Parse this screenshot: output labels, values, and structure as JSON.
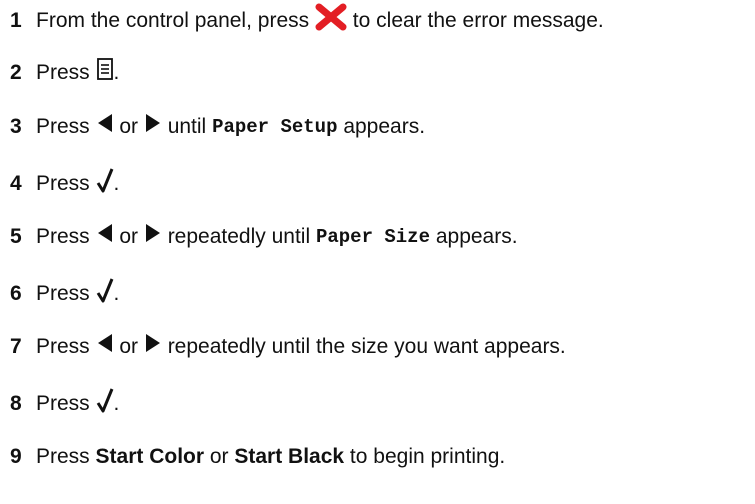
{
  "steps": [
    {
      "number": "1",
      "parts": {
        "a": "From the control panel, press ",
        "b": " to clear the error message."
      },
      "icons": [
        "cancel-x-icon"
      ]
    },
    {
      "number": "2",
      "parts": {
        "a": "Press ",
        "b": "."
      },
      "icons": [
        "menu-icon"
      ]
    },
    {
      "number": "3",
      "parts": {
        "a": "Press ",
        "or": " or ",
        "until": " until ",
        "code": "Paper Setup",
        "end": " appears."
      },
      "icons": [
        "left-arrow-icon",
        "right-arrow-icon"
      ]
    },
    {
      "number": "4",
      "parts": {
        "a": "Press ",
        "b": "."
      },
      "icons": [
        "checkmark-icon"
      ]
    },
    {
      "number": "5",
      "parts": {
        "a": "Press ",
        "or": " or ",
        "until": " repeatedly until ",
        "code": "Paper Size",
        "end": " appears."
      },
      "icons": [
        "left-arrow-icon",
        "right-arrow-icon"
      ]
    },
    {
      "number": "6",
      "parts": {
        "a": "Press ",
        "b": "."
      },
      "icons": [
        "checkmark-icon"
      ]
    },
    {
      "number": "7",
      "parts": {
        "a": "Press ",
        "or": " or ",
        "end": " repeatedly until the size you want appears."
      },
      "icons": [
        "left-arrow-icon",
        "right-arrow-icon"
      ]
    },
    {
      "number": "8",
      "parts": {
        "a": "Press ",
        "b": "."
      },
      "icons": [
        "checkmark-icon"
      ]
    },
    {
      "number": "9",
      "parts": {
        "a": "Press ",
        "bold1": "Start Color",
        "or": " or ",
        "bold2": "Start Black",
        "end": " to begin printing."
      }
    }
  ],
  "colors": {
    "cancel_icon": "#e31e24",
    "text": "#111111"
  }
}
